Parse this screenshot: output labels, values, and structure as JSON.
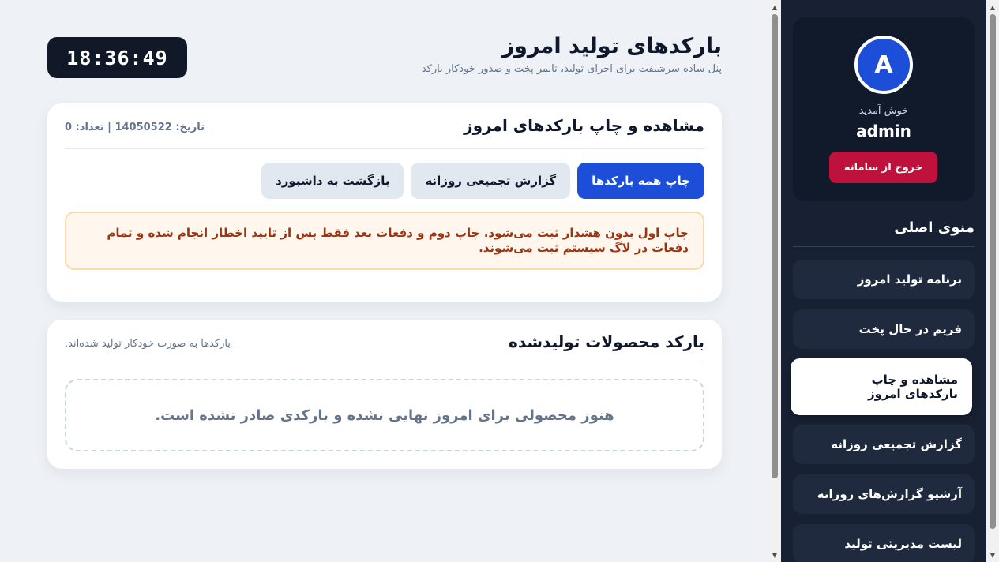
{
  "header": {
    "title": "بارکدهای تولید امروز",
    "subtitle": "پنل ساده سرشیفت برای اجرای تولید، تایمر پخت و صدور خودکار بارکد",
    "clock": "18:36:49"
  },
  "print_card": {
    "title": "مشاهده و چاپ بارکدهای امروز",
    "meta": "تاریخ: 14050522 | تعداد: 0",
    "buttons": {
      "print_all": "چاپ همه بارکدها",
      "daily_report": "گزارش تجمیعی روزانه",
      "back": "بازگشت به داشبورد"
    },
    "alert": "چاپ اول بدون هشدار ثبت می‌شود. چاپ دوم و دفعات بعد فقط پس از تایید اخطار انجام شده و تمام دفعات در لاگ سیستم ثبت می‌شوند."
  },
  "products_card": {
    "title": "بارکد محصولات تولیدشده",
    "note": "بارکدها به صورت خودکار تولید شده‌اند.",
    "empty_message": "هنوز محصولی برای امروز نهایی نشده و بارکدی صادر نشده است."
  },
  "sidebar": {
    "avatar_letter": "A",
    "welcome": "خوش آمدید",
    "username": "admin",
    "logout": "خروج از سامانه",
    "menu_title": "منوی اصلی",
    "items": [
      {
        "label": "برنامه تولید امروز"
      },
      {
        "label": "فریم در حال پخت"
      },
      {
        "label": "مشاهده و چاپ بارکدهای امروز"
      },
      {
        "label": "گزارش تجمیعی روزانه"
      },
      {
        "label": "آرشیو گزارش‌های روزانه"
      },
      {
        "label": "لیست مدیریتی تولید"
      }
    ],
    "active_index": 2
  },
  "colors": {
    "primary": "#1d4ed8",
    "danger": "#be123c",
    "sidebar_bg": "#172133",
    "alert_text": "#9a3412"
  }
}
